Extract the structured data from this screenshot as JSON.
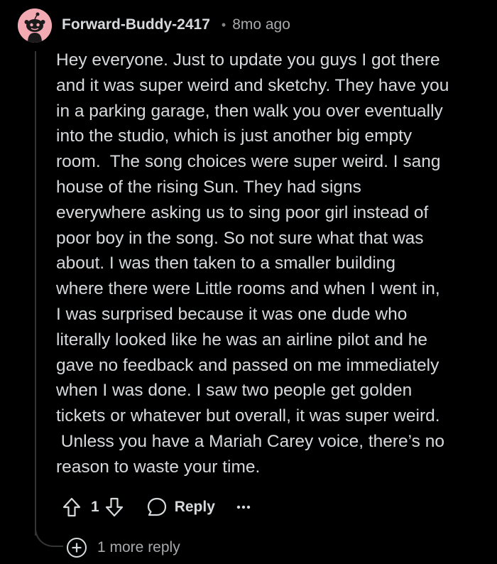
{
  "comment": {
    "author": "Forward-Buddy-2417",
    "separator": "•",
    "timestamp": "8mo ago",
    "body_lines": [
      "Hey everyone. Just to update you guys I got there",
      "and it was super weird and sketchy. They have you",
      "in a parking garage, then walk you over eventually",
      "into the studio, which is just another big empty",
      "room.  The song choices were super weird. I sang",
      "house of the rising Sun. They had signs",
      "everywhere asking us to sing poor girl instead of",
      "poor boy in the song. So not sure what that was",
      "about. I was then taken to a smaller building",
      "where there were Little rooms and when I went in,",
      "I was surprised because it was one dude who",
      "literally looked like he was an airline pilot and he",
      "gave no feedback and passed on me immediately",
      "when I was done. I saw two people get golden",
      "tickets or whatever but overall, it was super weird.",
      " Unless you have a Mariah Carey voice, there’s no",
      "reason to waste your time."
    ]
  },
  "actions": {
    "vote_count": "1",
    "reply_label": "Reply"
  },
  "more_replies": {
    "label": "1 more reply"
  },
  "icons": {
    "avatar": "reddit-snoo-avatar-icon",
    "upvote": "upvote-arrow-icon",
    "downvote": "downvote-arrow-icon",
    "reply": "speech-bubble-icon",
    "more": "ellipsis-icon",
    "expand": "plus-circle-icon"
  },
  "colors": {
    "background": "#000000",
    "text": "#d7dadc",
    "muted": "#a7a9ab",
    "avatar": "#f2a9b1",
    "thread_line": "#343536"
  }
}
